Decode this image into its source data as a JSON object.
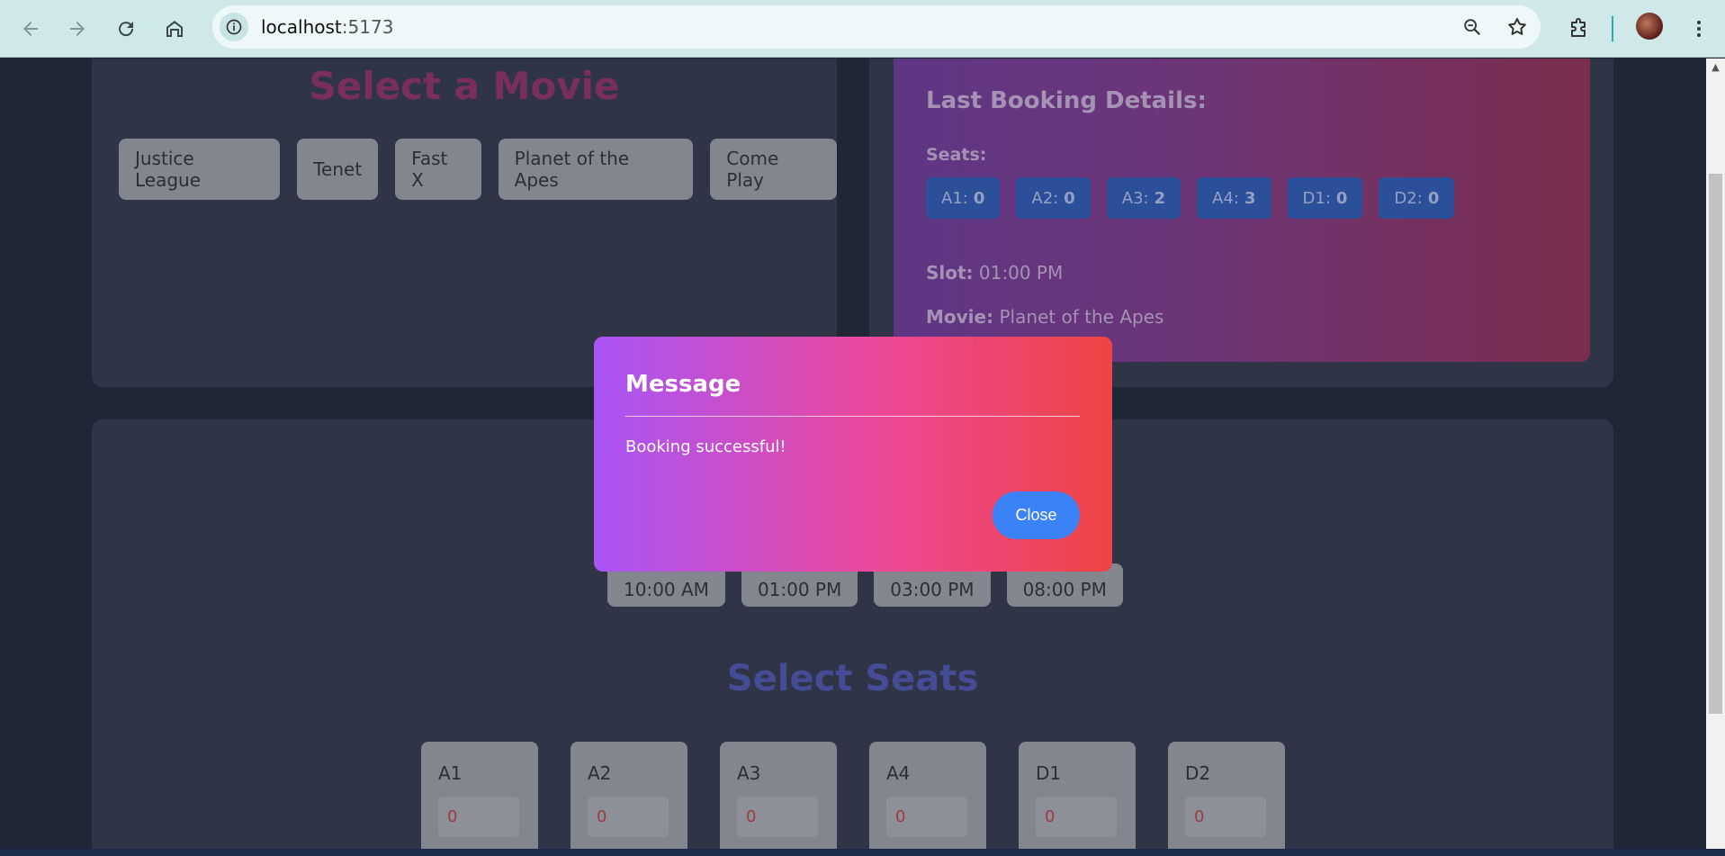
{
  "browser": {
    "url": "localhost:5173",
    "url_bold": "localhost",
    "url_rest": ":5173"
  },
  "movies": {
    "title": "Select a Movie",
    "items": [
      "Justice League",
      "Tenet",
      "Fast X",
      "Planet of the Apes",
      "Come Play"
    ]
  },
  "last_booking": {
    "title": "Last Booking Details:",
    "seats_label": "Seats:",
    "seats": [
      {
        "label": "A1:",
        "count": "0"
      },
      {
        "label": "A2:",
        "count": "0"
      },
      {
        "label": "A3:",
        "count": "2"
      },
      {
        "label": "A4:",
        "count": "3"
      },
      {
        "label": "D1:",
        "count": "0"
      },
      {
        "label": "D2:",
        "count": "0"
      }
    ],
    "slot_label": "Slot:",
    "slot_value": "01:00 PM",
    "movie_label": "Movie:",
    "movie_value": "Planet of the Apes"
  },
  "timeslots": {
    "items": [
      "10:00 AM",
      "01:00 PM",
      "03:00 PM",
      "08:00 PM"
    ]
  },
  "seat_select": {
    "title": "Select Seats",
    "seats": [
      {
        "name": "A1",
        "value": "0"
      },
      {
        "name": "A2",
        "value": "0"
      },
      {
        "name": "A3",
        "value": "0"
      },
      {
        "name": "A4",
        "value": "0"
      },
      {
        "name": "D1",
        "value": "0"
      },
      {
        "name": "D2",
        "value": "0"
      }
    ]
  },
  "modal": {
    "title": "Message",
    "message": "Booking successful!",
    "close_label": "Close"
  },
  "colors": {
    "modal_gradient_start": "#a855f7",
    "modal_gradient_end": "#ef4444",
    "close_button": "#3b82f6",
    "movie_title": "#ec4899",
    "seats_title": "#6366f1"
  }
}
